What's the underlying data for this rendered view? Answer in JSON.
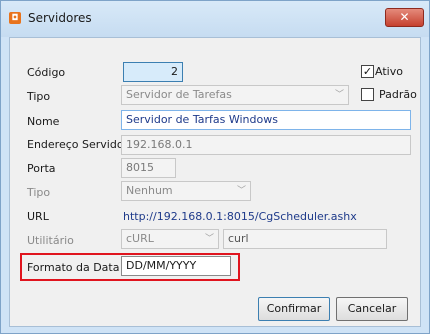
{
  "window": {
    "title": "Servidores",
    "app_icon": "servidores-app-icon",
    "close_label": "✕"
  },
  "fields": {
    "codigo": {
      "label": "Código",
      "value": "2"
    },
    "ativo": {
      "label": "Ativo",
      "checked": true
    },
    "tipo": {
      "label": "Tipo",
      "value": "Servidor de Tarefas"
    },
    "padrao": {
      "label": "Padrão",
      "checked": false
    },
    "nome": {
      "label": "Nome",
      "value": "Servidor de Tarfas Windows"
    },
    "endereco": {
      "label": "Endereço Servidor",
      "value": "192.168.0.1"
    },
    "porta": {
      "label": "Porta",
      "value": "8015"
    },
    "tipo2": {
      "label": "Tipo",
      "value": "Nenhum"
    },
    "url": {
      "label": "URL",
      "value": "http://192.168.0.1:8015/CgScheduler.ashx"
    },
    "utilitario": {
      "label": "Utilitário",
      "value": "cURL",
      "extra": "curl"
    },
    "formato_data": {
      "label": "Formato da Data",
      "value": "DD/MM/YYYY"
    }
  },
  "buttons": {
    "confirm": "Confirmar",
    "cancel": "Cancelar"
  },
  "colors": {
    "highlight": "#e0141e",
    "title_bar": "#cfe3f6",
    "close": "#c5412f"
  }
}
